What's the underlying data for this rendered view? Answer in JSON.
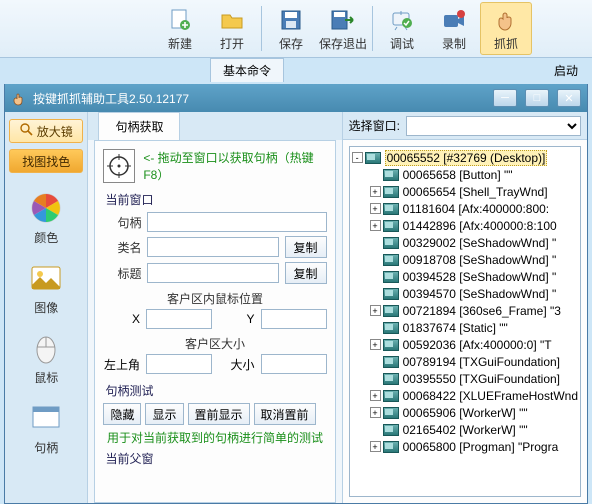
{
  "toolbar": {
    "new": "新建",
    "open": "打开",
    "save": "保存",
    "saveexit": "保存退出",
    "debug": "调试",
    "record": "录制",
    "grab": "抓抓"
  },
  "under_tab": "基本命令",
  "launch_label": "启动",
  "window_title": "按键抓抓辅助工具2.50.12177",
  "left": {
    "magnifier": "放大镜",
    "findimgcolor": "找图找色",
    "color": "颜色",
    "image": "图像",
    "mouse": "鼠标",
    "handle": "句柄"
  },
  "center": {
    "tab": "句柄获取",
    "drag_hint": "<- 拖动至窗口以获取句柄（热键F8）",
    "curwin": "当前窗口",
    "handle": "句柄",
    "classname": "类名",
    "title": "标题",
    "copy": "复制",
    "mousepos_title": "客户区内鼠标位置",
    "x": "X",
    "y": "Y",
    "clientsize_title": "客户区大小",
    "topleft": "左上角",
    "size": "大小",
    "handletest": "句柄测试",
    "hide": "隐藏",
    "show": "显示",
    "front": "置前显示",
    "cancelfront": "取消置前",
    "test_note": "用于对当前获取到的句柄进行简单的测试",
    "curparent": "当前父窗"
  },
  "right": {
    "select_window_label": "选择窗口:",
    "tree": [
      {
        "d": 0,
        "t": "-",
        "txt": "00065552 [#32769 (Desktop)]",
        "sel": true
      },
      {
        "d": 1,
        "t": "",
        "txt": "00065658 [Button] \"\""
      },
      {
        "d": 1,
        "t": "+",
        "txt": "00065654 [Shell_TrayWnd]"
      },
      {
        "d": 1,
        "t": "+",
        "txt": "01181604 [Afx:400000:800:"
      },
      {
        "d": 1,
        "t": "+",
        "txt": "01442896 [Afx:400000:8:100"
      },
      {
        "d": 1,
        "t": "",
        "txt": "00329002 [SeShadowWnd] \""
      },
      {
        "d": 1,
        "t": "",
        "txt": "00918708 [SeShadowWnd] \""
      },
      {
        "d": 1,
        "t": "",
        "txt": "00394528 [SeShadowWnd] \""
      },
      {
        "d": 1,
        "t": "",
        "txt": "00394570 [SeShadowWnd] \""
      },
      {
        "d": 1,
        "t": "+",
        "txt": "00721894 [360se6_Frame] \"3"
      },
      {
        "d": 1,
        "t": "",
        "txt": "01837674 [Static] \"\""
      },
      {
        "d": 1,
        "t": "+",
        "txt": "00592036 [Afx:400000:0] \"T"
      },
      {
        "d": 1,
        "t": "",
        "txt": "00789194 [TXGuiFoundation]"
      },
      {
        "d": 1,
        "t": "",
        "txt": "00395550 [TXGuiFoundation]"
      },
      {
        "d": 1,
        "t": "+",
        "txt": "00068422 [XLUEFrameHostWnd"
      },
      {
        "d": 1,
        "t": "+",
        "txt": "00065906 [WorkerW] \"\""
      },
      {
        "d": 1,
        "t": "",
        "txt": "02165402 [WorkerW] \"\""
      },
      {
        "d": 1,
        "t": "+",
        "txt": "00065800 [Progman] \"Progra"
      }
    ]
  }
}
